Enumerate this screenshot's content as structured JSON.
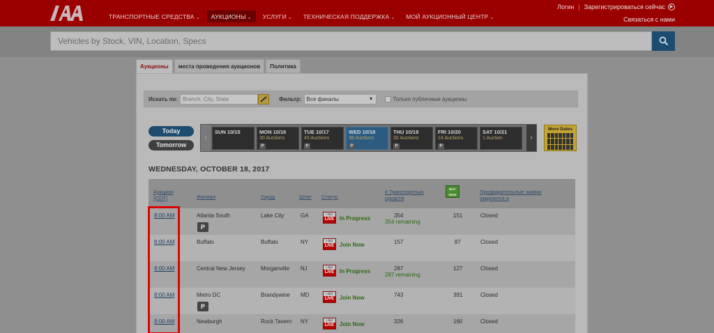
{
  "header": {
    "nav": [
      {
        "label": "ТРАНСПОРТНЫЕ СРЕДСТВА",
        "active": false
      },
      {
        "label": "АУКЦИОНЫ",
        "active": true
      },
      {
        "label": "УСЛУГИ",
        "active": false
      },
      {
        "label": "ТЕХНИЧЕСКАЯ ПОДДЕРЖКА",
        "active": false
      },
      {
        "label": "МОЙ АУКЦИОННЫЙ ЦЕНТР",
        "active": false
      }
    ],
    "login": "Логин",
    "register": "Зарегистрироваться сейчас",
    "contact": "Связаться с нами"
  },
  "search": {
    "placeholder": "Vehicles by Stock, VIN, Location, Specs"
  },
  "tabs": [
    "Аукционы",
    "места проведения аукционов",
    "Политика"
  ],
  "filters": {
    "search_label": "Искать по:",
    "location_placeholder": "Branch, City, State",
    "filter_label": "Фильтр:",
    "filter_value": "Все финалы",
    "public_only": "Только публичные аукционы"
  },
  "day_buttons": {
    "today": "Today",
    "tomorrow": "Tomorrow"
  },
  "dates": [
    {
      "day": "SUN 10/15",
      "count": "",
      "p": false
    },
    {
      "day": "MON 10/16",
      "count": "30 Auctions",
      "p": true
    },
    {
      "day": "TUE 10/17",
      "count": "43 Auctions",
      "p": true
    },
    {
      "day": "WED 10/18",
      "count": "38 Auctions",
      "p": true,
      "selected": true
    },
    {
      "day": "THU 10/19",
      "count": "30 Auctions",
      "p": true
    },
    {
      "day": "FRI 10/20",
      "count": "14 Auctions",
      "p": true
    },
    {
      "day": "SAT 10/21",
      "count": "1 Auction",
      "p": false
    }
  ],
  "more_dates": "More Dates",
  "section_title": "WEDNESDAY, OCTOBER 18, 2017",
  "table": {
    "headers": {
      "auction": "Аукцион (CDT)",
      "branch": "Филиал",
      "city": "Город",
      "state": "Штат",
      "status": "Статус",
      "vehicles": "# Транспортных средств",
      "badge": "BUY NOW",
      "prebid": "Предварительные заявки закроются в"
    },
    "rows": [
      {
        "time": "8:00 AM",
        "branch": "Atlanta South",
        "city": "Lake City",
        "state": "GA",
        "status": "In Progress",
        "vehicles": "354",
        "remaining": "354 remaining",
        "count": "151",
        "prebid": "Closed",
        "p": true
      },
      {
        "time": "8:00 AM",
        "branch": "Buffalo",
        "city": "Buffalo",
        "state": "NY",
        "status": "Join Now",
        "vehicles": "157",
        "remaining": "",
        "count": "87",
        "prebid": "Closed",
        "p": false
      },
      {
        "time": "8:00 AM",
        "branch": "Central New Jersey",
        "city": "Morganville",
        "state": "NJ",
        "status": "In Progress",
        "vehicles": "287",
        "remaining": "287 remaining",
        "count": "127",
        "prebid": "Closed",
        "p": false
      },
      {
        "time": "8:00 AM",
        "branch": "Metro DC",
        "city": "Brandywine",
        "state": "MD",
        "status": "Join Now",
        "vehicles": "743",
        "remaining": "",
        "count": "391",
        "prebid": "Closed",
        "p": true
      },
      {
        "time": "8:00 AM",
        "branch": "Newburgh",
        "city": "Rock Tavern",
        "state": "NY",
        "status": "Join Now",
        "vehicles": "326",
        "remaining": "",
        "count": "160",
        "prebid": "Closed",
        "p": false
      }
    ]
  },
  "live_badge": {
    "top": "i-bid",
    "label": "LIVE"
  },
  "colors": {
    "header": "#9b0000",
    "search_button": "#1c4d70",
    "highlight": "#e00000",
    "status_green": "#2a6a12"
  }
}
